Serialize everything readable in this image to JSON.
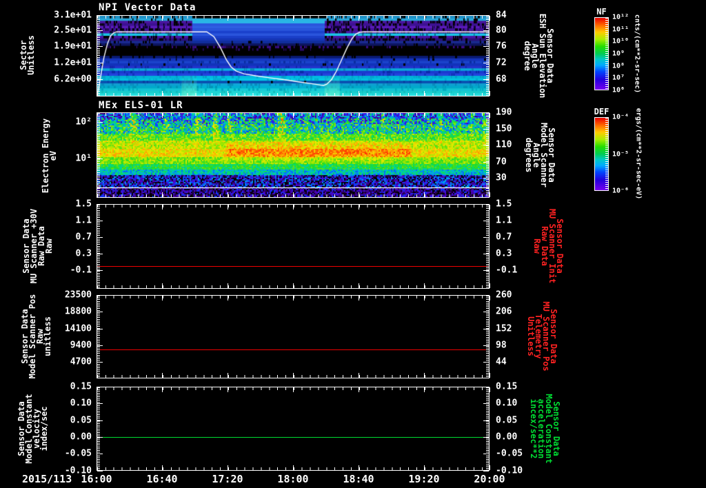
{
  "background": "#000000",
  "chart_data": {
    "date_label": "2015/113",
    "x_axis": {
      "tick_labels": [
        "16:00",
        "16:40",
        "17:20",
        "18:00",
        "18:40",
        "19:20",
        "20:00"
      ],
      "tick_fracs": [
        0,
        0.1667,
        0.3333,
        0.5,
        0.6667,
        0.8333,
        1
      ]
    },
    "panels": [
      {
        "type": "heatmap",
        "title": "NPI Vector Data",
        "left_axis": {
          "label": "Sector\nUnitless",
          "ticks": [
            "3.1e+01",
            "2.5e+01",
            "1.9e+01",
            "1.2e+01",
            "6.2e+00"
          ],
          "fracs": [
            0,
            0.19,
            0.38,
            0.585,
            0.79
          ]
        },
        "right_axis": {
          "label": "Sensor Data\nESH Sun Elevation\nAngle\ndegree",
          "label_color": "#ffffff",
          "ticks": [
            "84",
            "80",
            "76",
            "72",
            "68"
          ],
          "fracs": [
            0,
            0.19,
            0.38,
            0.585,
            0.79
          ],
          "value_top": 84,
          "value_bottom": 64
        },
        "overlay_line": {
          "name": "ESH Sun Elevation Angle (degree)",
          "color": "#ffffff",
          "points": [
            [
              0.0,
              64.2
            ],
            [
              0.004,
              66.0
            ],
            [
              0.01,
              69.5
            ],
            [
              0.017,
              73.5
            ],
            [
              0.026,
              77.0
            ],
            [
              0.034,
              79.0
            ],
            [
              0.043,
              79.8
            ],
            [
              0.05,
              80.0
            ],
            [
              0.28,
              80.0
            ],
            [
              0.298,
              78.8
            ],
            [
              0.315,
              76.0
            ],
            [
              0.33,
              73.0
            ],
            [
              0.342,
              71.2
            ],
            [
              0.355,
              70.2
            ],
            [
              0.375,
              69.5
            ],
            [
              0.405,
              69.0
            ],
            [
              0.44,
              68.5
            ],
            [
              0.48,
              68.0
            ],
            [
              0.52,
              67.4
            ],
            [
              0.55,
              67.0
            ],
            [
              0.57,
              66.7
            ],
            [
              0.578,
              66.6
            ],
            [
              0.586,
              66.9
            ],
            [
              0.598,
              68.0
            ],
            [
              0.61,
              70.0
            ],
            [
              0.624,
              73.0
            ],
            [
              0.638,
              76.0
            ],
            [
              0.65,
              78.2
            ],
            [
              0.66,
              79.4
            ],
            [
              0.67,
              79.9
            ],
            [
              0.68,
              80.0
            ],
            [
              1.0,
              80.0
            ]
          ]
        },
        "heatmap": {
          "mid_x_range": [
            0.24,
            0.578
          ],
          "glow_blobs_x": [
            0.235,
            0.6
          ],
          "rows_top_to_bottom": [
            [
              "#1f8fc4",
              "#000000",
              0.38,
              "#000000",
              "#000000",
              0
            ],
            [
              "#27a6da",
              "#000000",
              0.2,
              "#2ab7e6",
              "#000000",
              0
            ],
            [
              "#4a149e",
              "#000000",
              0.45,
              "#2bb9e8",
              "#000000",
              0.02
            ],
            [
              "#3c1192",
              "#000000",
              0.45,
              "#2a55dd",
              "#000000",
              0
            ],
            [
              "#5a1ab8",
              "#0c0330",
              0.42,
              "#2e5ee2",
              "#000000",
              0
            ],
            [
              "#44129a",
              "#000000",
              0.48,
              "#2a55dd",
              "#000000",
              0
            ],
            [
              "#4a14a2",
              "#120430",
              0.5,
              "#1a40cc",
              "#000000",
              0
            ],
            [
              "#19c4e6",
              "#0a7090",
              0.12,
              "#2a55dd",
              "#000000",
              0
            ],
            [
              "#4a14a2",
              "#000000",
              0.5,
              "#1a3fc8",
              "#000000",
              0
            ],
            [
              "#2a1078",
              "#000000",
              0.5,
              "#1535b5",
              "#000000",
              0
            ],
            [
              "#1a2a90",
              "#000000",
              0.22,
              "#112e9e",
              "#000000",
              0.05
            ],
            [
              "#0d1560",
              "#000000",
              0.25,
              "#0d1560",
              "#000000",
              0.2
            ],
            [
              "#000000",
              "#3a0c86",
              0.3,
              "#000000",
              "#3a0c86",
              0.5
            ],
            [
              "#000000",
              "#000000",
              0,
              "#000000",
              "#2a0a66",
              0.25
            ],
            [
              "#000000",
              "#000000",
              0,
              "#000000",
              "#000000",
              0
            ],
            [
              "#000000",
              "#000000",
              0,
              "#000000",
              "#000000",
              0
            ],
            [
              "#0a1a70",
              "#000000",
              0.15,
              "#0a1a70",
              "#000000",
              0.1
            ],
            [
              "#1333bb",
              "#000000",
              0.08,
              "#1638c2",
              "#000000",
              0
            ],
            [
              "#1a44cc",
              "#0a2ea0",
              0.3,
              "#1a44cc",
              "#0a2ea0",
              0.3
            ],
            [
              "#1133bb",
              "#000000",
              0.1,
              "#1133bb",
              "#000000",
              0.05
            ],
            [
              "#2233cc",
              "#1128aa",
              0.3,
              "#2233cc",
              "#1128aa",
              0.3
            ],
            [
              "#0aa8d8",
              "#0888b8",
              0.28,
              "#0ab0e0",
              "#0888b8",
              0.2
            ],
            [
              "#1a3ad0",
              "#0a2aaa",
              0.3,
              "#1a3ad0",
              "#0a2aaa",
              0.3
            ],
            [
              "#2244dd",
              "#1133bb",
              0.3,
              "#2244dd",
              "#1133bb",
              0.3
            ],
            [
              "#00b4d8",
              "#00a0c8",
              0.35,
              "#00bce0",
              "#00a0c8",
              0.3
            ],
            [
              "#00c0e0",
              "#00aad0",
              0.3,
              "#00c8e8",
              "#00aad0",
              0.3
            ],
            [
              "#0a4db0",
              "#0a3da0",
              0.3,
              "#0a4db0",
              "#000000",
              0.05
            ],
            [
              "#0f9fd0",
              "#0a8abd",
              0.3,
              "#0fa8d8",
              "#0a8abd",
              0.3
            ],
            [
              "#00aacb",
              "#0096b8",
              0.3,
              "#00b2d4",
              "#0096b8",
              0.3
            ],
            [
              "#12c4d4",
              "#00aac0",
              0.3,
              "#16ccd8",
              "#00aac0",
              0.3
            ],
            [
              "#19cccc",
              "#12bcbc",
              0.3,
              "#1fd4d4",
              "#12bcbc",
              0.3
            ],
            [
              "#26dede",
              "#1acccc",
              0.28,
              "#2ee6e6",
              "#1acccc",
              0.28
            ]
          ]
        },
        "colorbar": {
          "title": "NF",
          "tick_labels": [
            "10¹²",
            "10¹¹",
            "10¹⁰",
            "10⁹",
            "10⁸",
            "10⁷",
            "10⁶"
          ],
          "units": "cnts/(cm**2-sr-sec)"
        }
      },
      {
        "type": "heatmap",
        "title": "MEx ELS-01 LR",
        "left_axis": {
          "label": "Electron Energy\neV",
          "ticks": [
            "10²",
            "10¹"
          ],
          "fracs": [
            0.113,
            0.54
          ]
        },
        "right_axis": {
          "label": "Sensor Data\nModel Scanner\nAngle\ndegrees",
          "label_color": "#ffffff",
          "ticks": [
            "190",
            "150",
            "110",
            "70",
            "30"
          ],
          "fracs": [
            0,
            0.19,
            0.38,
            0.58,
            0.77
          ]
        },
        "heatmap": {
          "divider_frac": 0.885,
          "profile": [
            [
              0,
              0.05,
              0.3,
              0.22
            ],
            [
              0.05,
              0.13,
              0.4,
              0.26
            ],
            [
              0.13,
              0.24,
              0.48,
              0.22
            ],
            [
              0.24,
              0.32,
              0.6,
              0.12
            ],
            [
              0.32,
              0.42,
              0.7,
              0.1
            ],
            [
              0.42,
              0.52,
              0.76,
              0.09
            ],
            [
              0.52,
              0.6,
              0.64,
              0.09
            ],
            [
              0.6,
              0.67,
              0.54,
              0.09
            ],
            [
              0.67,
              0.73,
              0.42,
              0.12
            ],
            [
              0.73,
              0.88,
              0.17,
              0.22
            ],
            [
              0.88,
              1.01,
              0.1,
              0.17
            ]
          ],
          "core_boost": {
            "x": [
              0.33,
              0.8
            ],
            "y": [
              0.34,
              0.56
            ],
            "amount": 0.1
          },
          "streaks": [
            [
              0.09,
              0.3,
              0.01
            ],
            [
              0.175,
              0.18,
              0.007
            ],
            [
              0.254,
              0.2,
              0.007
            ],
            [
              0.3,
              0.26,
              0.008
            ],
            [
              0.335,
              0.22,
              0.006
            ],
            [
              0.368,
              0.16,
              0.005
            ],
            [
              0.468,
              0.34,
              0.01
            ],
            [
              0.535,
              0.16,
              0.006
            ],
            [
              0.6,
              0.13,
              0.005
            ],
            [
              0.728,
              0.18,
              0.006
            ],
            [
              0.877,
              0.15,
              0.005
            ],
            [
              0.955,
              0.2,
              0.006
            ],
            [
              0.985,
              0.16,
              0.005
            ]
          ]
        },
        "colorbar": {
          "title": "DEF",
          "tick_labels": [
            "10⁻⁴",
            "10⁻⁵",
            "10⁻⁶"
          ],
          "units": "ergs/(cm**2-sr-sec-eV)"
        }
      },
      {
        "type": "line",
        "left_axis": {
          "label": "Sensor Data\nMU Scanner +30V\nRaw Data\nRaw",
          "ticks": [
            "1.5",
            "1.1",
            "0.7",
            "0.3",
            "-0.1"
          ],
          "fracs": [
            0,
            0.195,
            0.39,
            0.585,
            0.78
          ]
        },
        "right_axis": {
          "label": "Sensor Data\nMU Scanner Init\nRaw Data\nRaw",
          "label_color": "#ff2222",
          "ticks": [
            "1.5",
            "1.1",
            "0.7",
            "0.3",
            "-0.1"
          ],
          "fracs": [
            0,
            0.195,
            0.39,
            0.585,
            0.78
          ]
        },
        "series": {
          "name": "MU Scanner +30V Raw Data",
          "color": "#ee0000",
          "value": 0.0,
          "y_top": 1.5,
          "y_bottom": -0.55
        }
      },
      {
        "type": "line",
        "left_axis": {
          "label": "Sensor Data\nModel Scanner Pos\nRaw\nunitless",
          "ticks": [
            "23500",
            "18800",
            "14100",
            "9400",
            "4700"
          ],
          "fracs": [
            0,
            0.198,
            0.405,
            0.603,
            0.802
          ]
        },
        "right_axis": {
          "label": "Sensor Data\nMU Scanner Pos\nTelemetry\nUnitless",
          "label_color": "#ff2222",
          "ticks": [
            "260",
            "206",
            "152",
            "98",
            "44"
          ],
          "fracs": [
            0,
            0.198,
            0.405,
            0.603,
            0.802
          ]
        },
        "series": {
          "name": "Model Scanner Pos Raw",
          "color": "#ee0000",
          "value": 8000,
          "y_top": 23500,
          "y_bottom": 0
        }
      },
      {
        "type": "line",
        "left_axis": {
          "label": "Sensor Data\nModel Constant\nvelocity\nindex/sec",
          "ticks": [
            "0.15",
            "0.10",
            "0.05",
            "0.00",
            "-0.05",
            "-0.10"
          ],
          "fracs": [
            0,
            0.197,
            0.402,
            0.598,
            0.795,
            1
          ]
        },
        "right_axis": {
          "label": "Sensor Data\nModel Constant\nacceleration\nincex/sec**2",
          "label_color": "#00dd33",
          "ticks": [
            "0.15",
            "0.10",
            "0.05",
            "0.00",
            "-0.05",
            "-0.10"
          ],
          "fracs": [
            0,
            0.197,
            0.402,
            0.598,
            0.795,
            1
          ]
        },
        "series": {
          "name": "Model Constant velocity",
          "color": "#00dd33",
          "value": 0.0,
          "y_top": 0.15,
          "y_bottom": -0.1
        }
      }
    ]
  }
}
